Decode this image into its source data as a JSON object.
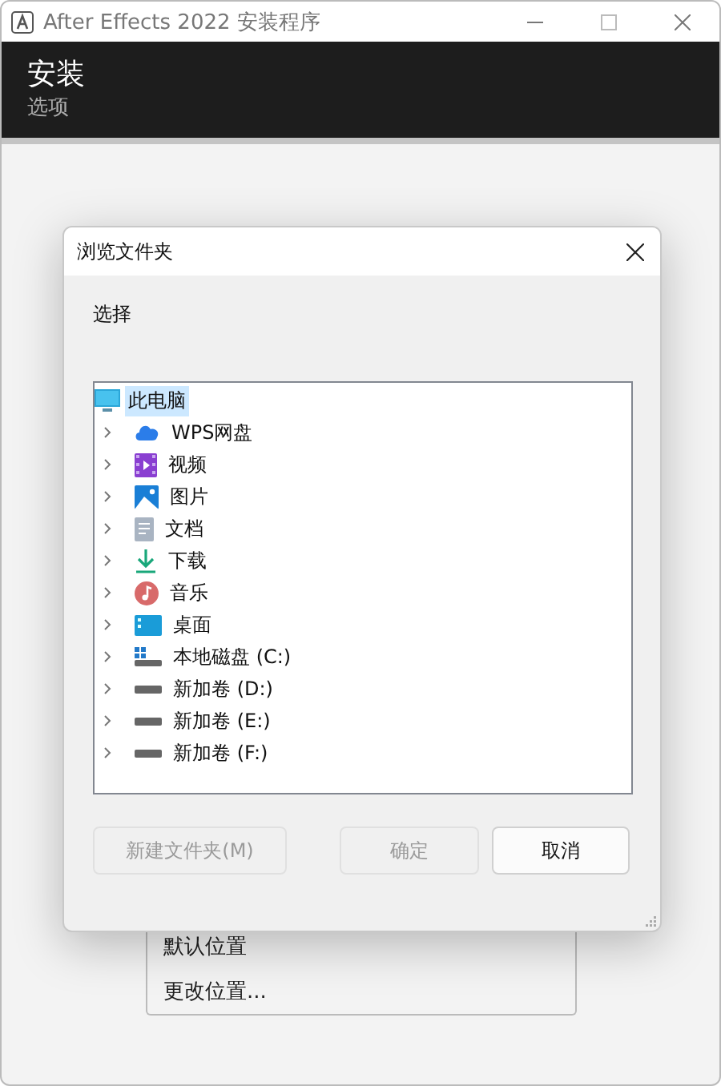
{
  "window": {
    "title": "After Effects 2022 安装程序",
    "header_title": "安装",
    "header_subtitle": "选项"
  },
  "location_menu": {
    "items": [
      {
        "label": "默认位置"
      },
      {
        "label": "更改位置..."
      }
    ]
  },
  "dialog": {
    "title": "浏览文件夹",
    "prompt": "选择",
    "tree": {
      "label": "此电脑",
      "kind": "computer",
      "selected": true,
      "expanded": true,
      "children": [
        {
          "label": "WPS网盘",
          "kind": "cloud",
          "selected": false,
          "expanded": false
        },
        {
          "label": "视频",
          "kind": "video",
          "selected": false,
          "expanded": false
        },
        {
          "label": "图片",
          "kind": "picture",
          "selected": false,
          "expanded": false
        },
        {
          "label": "文档",
          "kind": "document",
          "selected": false,
          "expanded": false
        },
        {
          "label": "下载",
          "kind": "download",
          "selected": false,
          "expanded": false
        },
        {
          "label": "音乐",
          "kind": "music",
          "selected": false,
          "expanded": false
        },
        {
          "label": "桌面",
          "kind": "desktop",
          "selected": false,
          "expanded": false
        },
        {
          "label": "本地磁盘 (C:)",
          "kind": "system-drive",
          "selected": false,
          "expanded": false
        },
        {
          "label": "新加卷 (D:)",
          "kind": "drive",
          "selected": false,
          "expanded": false
        },
        {
          "label": "新加卷 (E:)",
          "kind": "drive",
          "selected": false,
          "expanded": false
        },
        {
          "label": "新加卷 (F:)",
          "kind": "drive",
          "selected": false,
          "expanded": false
        }
      ]
    },
    "buttons": [
      {
        "label": "新建文件夹(M)",
        "disabled": true
      },
      {
        "label": "确定",
        "disabled": true
      },
      {
        "label": "取消",
        "disabled": false
      }
    ]
  }
}
